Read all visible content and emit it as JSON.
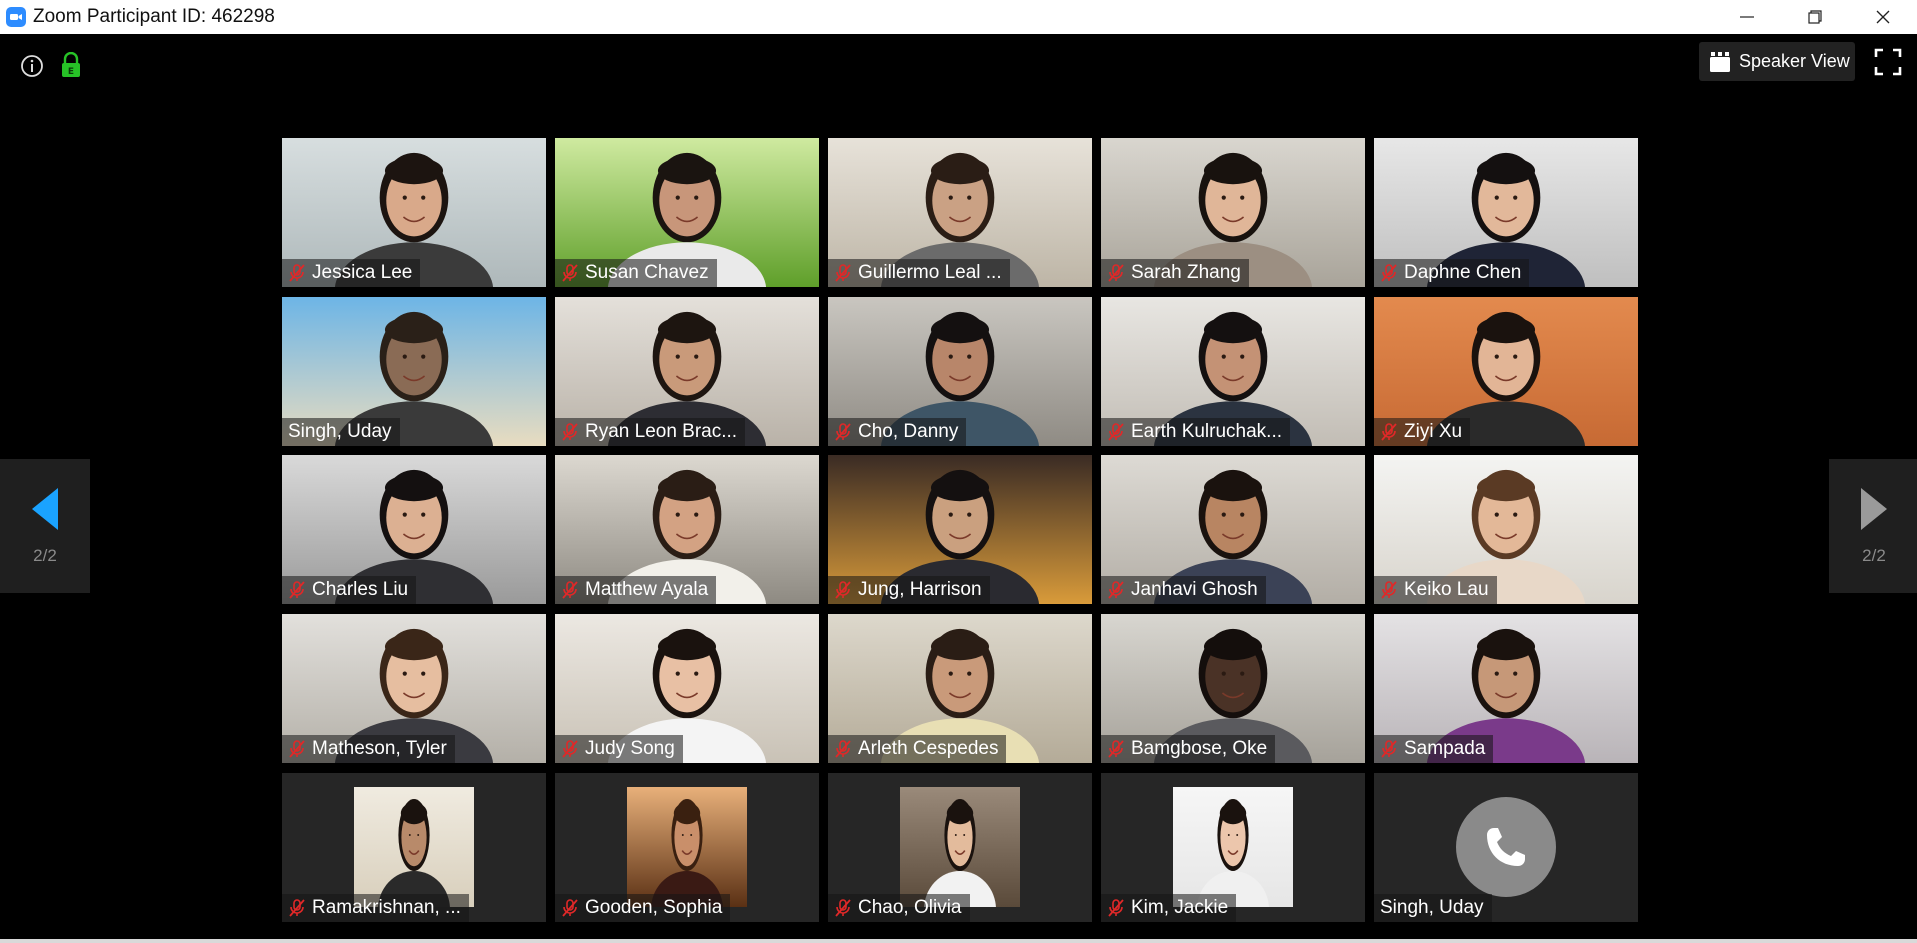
{
  "window": {
    "title": "Zoom Participant ID: 462298"
  },
  "toolbar": {
    "speaker_view_label": "Speaker View"
  },
  "pager": {
    "prev_label": "2/2",
    "next_label": "2/2"
  },
  "colors": {
    "accent": "#2d8cff",
    "lock_green": "#27c227",
    "pager_arrow_active": "#1aa3ff",
    "pager_arrow_inactive": "#9a9a9a",
    "mute_red": "#e02828"
  },
  "participants": [
    {
      "name": "Jessica Lee",
      "muted": true,
      "bg": [
        "#d7dedf",
        "#aeb8ba"
      ],
      "skin": "#d9a98a",
      "hair": "#1c1410",
      "shirt": "#3b3b3b"
    },
    {
      "name": "Susan Chavez",
      "muted": true,
      "bg": [
        "#cfeaa0",
        "#5f9f2a"
      ],
      "skin": "#c8967a",
      "hair": "#1a1410",
      "shirt": "#eaeaea"
    },
    {
      "name": "Guillermo Leal ...",
      "muted": true,
      "bg": [
        "#e7e2d9",
        "#bdb5a6"
      ],
      "skin": "#caa184",
      "hair": "#2a1d15",
      "shirt": "#6b6b6b"
    },
    {
      "name": "Sarah Zhang",
      "muted": true,
      "bg": [
        "#d9d6cf",
        "#a9a49a"
      ],
      "skin": "#e0b698",
      "hair": "#18120e",
      "shirt": "#9c8f82"
    },
    {
      "name": "Daphne Chen",
      "muted": true,
      "bg": [
        "#e7e7e7",
        "#bfbfbf"
      ],
      "skin": "#e2b89a",
      "hair": "#141010",
      "shirt": "#1f2436"
    },
    {
      "name": "Singh, Uday",
      "muted": false,
      "bg": [
        "#6db5e6",
        "#e8dcc0"
      ],
      "skin": "#8a6b55",
      "hair": "#2a2018",
      "shirt": "#3a3a3a"
    },
    {
      "name": "Ryan Leon Brac...",
      "muted": true,
      "bg": [
        "#e4e0da",
        "#b9b2a8"
      ],
      "skin": "#c99a7a",
      "hair": "#1d1510",
      "shirt": "#2d2d33"
    },
    {
      "name": "Cho, Danny",
      "muted": true,
      "bg": [
        "#c9c6c0",
        "#8f8b84"
      ],
      "skin": "#b8866a",
      "hair": "#141010",
      "shirt": "#3e5566"
    },
    {
      "name": "Earth Kulruchak...",
      "muted": true,
      "bg": [
        "#e8e6e2",
        "#c2bdb5"
      ],
      "skin": "#c49275",
      "hair": "#141010",
      "shirt": "#2b3340"
    },
    {
      "name": "Ziyi Xu",
      "muted": true,
      "bg": [
        "#e38a4e",
        "#c76a34"
      ],
      "skin": "#e2b596",
      "hair": "#1a120e",
      "shirt": "#2a2a2a"
    },
    {
      "name": "Charles Liu",
      "muted": true,
      "bg": [
        "#d9d9d9",
        "#9a9a9a"
      ],
      "skin": "#dcb092",
      "hair": "#141010",
      "shirt": "#2f2f33"
    },
    {
      "name": "Matthew Ayala",
      "muted": true,
      "bg": [
        "#dcd8d0",
        "#8e8a82"
      ],
      "skin": "#d3a283",
      "hair": "#2a1d15",
      "shirt": "#f2f0ea"
    },
    {
      "name": "Jung, Harrison",
      "muted": true,
      "bg": [
        "#3a2b24",
        "#d99b3a"
      ],
      "skin": "#caa07f",
      "hair": "#141010",
      "shirt": "#2a2a30"
    },
    {
      "name": "Janhavi Ghosh",
      "muted": true,
      "bg": [
        "#dddad4",
        "#b3aea6"
      ],
      "skin": "#b88562",
      "hair": "#1a120e",
      "shirt": "#3b4256"
    },
    {
      "name": "Keiko Lau",
      "muted": true,
      "bg": [
        "#f4f4f2",
        "#d8d4cc"
      ],
      "skin": "#e3b898",
      "hair": "#5a3a24",
      "shirt": "#e8d8c8"
    },
    {
      "name": "Matheson, Tyler",
      "muted": true,
      "bg": [
        "#e2e0dc",
        "#b4b0a8"
      ],
      "skin": "#e6bea0",
      "hair": "#3a2618",
      "shirt": "#3a3a40"
    },
    {
      "name": "Judy Song",
      "muted": true,
      "bg": [
        "#ece8e2",
        "#c9c2b6"
      ],
      "skin": "#e8c0a4",
      "hair": "#1a120e",
      "shirt": "#f4f4f4"
    },
    {
      "name": "Arleth Cespedes",
      "muted": true,
      "bg": [
        "#ddd8cc",
        "#b4ab98"
      ],
      "skin": "#c99a7a",
      "hair": "#2a1d15",
      "shirt": "#e8dfb4"
    },
    {
      "name": "Bamgbose, Oke",
      "muted": true,
      "bg": [
        "#d8d6d0",
        "#a6a29a"
      ],
      "skin": "#4a3226",
      "hair": "#140e0c",
      "shirt": "#5a5a5e"
    },
    {
      "name": "Sampada",
      "muted": true,
      "bg": [
        "#e4e2e4",
        "#b9b4b8"
      ],
      "skin": "#c69878",
      "hair": "#1a120e",
      "shirt": "#7a3a8a"
    },
    {
      "name": "Ramakrishnan, ...",
      "muted": true,
      "avatar": true,
      "bg": [
        "#f0ebe0",
        "#d8cfbc"
      ],
      "skin": "#b88a6a",
      "hair": "#1a120e",
      "shirt": "#2a2a2a"
    },
    {
      "name": "Gooden, Sophia",
      "muted": true,
      "avatar": true,
      "bg": [
        "#e8b07a",
        "#5a3014"
      ],
      "skin": "#c98f6a",
      "hair": "#3a2010",
      "shirt": "#3a1a14"
    },
    {
      "name": "Chao, Olivia",
      "muted": true,
      "avatar": true,
      "bg": [
        "#9a8a7a",
        "#5a4a3a"
      ],
      "skin": "#e3bb9c",
      "hair": "#1a120e",
      "shirt": "#f2f2f2"
    },
    {
      "name": "Kim, Jackie",
      "muted": true,
      "avatar": true,
      "bg": [
        "#f6f6f6",
        "#e6e6e6"
      ],
      "skin": "#ecc6ac",
      "hair": "#1a120e",
      "shirt": "#f0f0f0"
    },
    {
      "name": "Singh, Uday",
      "muted": false,
      "call": true
    }
  ]
}
